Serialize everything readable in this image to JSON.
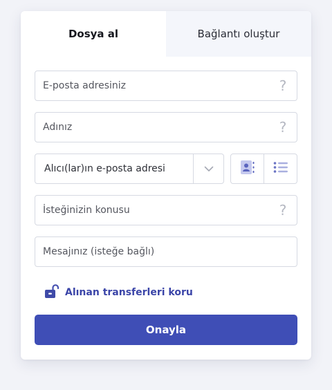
{
  "tabs": [
    {
      "label": "Dosya al",
      "active": true
    },
    {
      "label": "Bağlantı oluştur",
      "active": false
    }
  ],
  "fields": {
    "email": {
      "placeholder": "E-posta adresiniz",
      "help": "?"
    },
    "name": {
      "placeholder": "Adınız",
      "help": "?"
    },
    "recipients": {
      "placeholder": "Alıcı(lar)ın e-posta adresi"
    },
    "subject": {
      "placeholder": "İsteğinizin konusu",
      "help": "?"
    },
    "message": {
      "placeholder": "Mesajınız (isteğe bağlı)"
    }
  },
  "protect": {
    "label": "Alınan transferleri koru"
  },
  "submit": {
    "label": "Onayla"
  },
  "colors": {
    "accent": "#3f4eb6",
    "link": "#3b45a8",
    "icon": "#6b74c4"
  },
  "icons": {
    "recipient_dropdown": "chevron-down-icon",
    "contacts": "contact-book-icon",
    "list": "list-icon",
    "protect": "unlocked-padlock-icon"
  }
}
